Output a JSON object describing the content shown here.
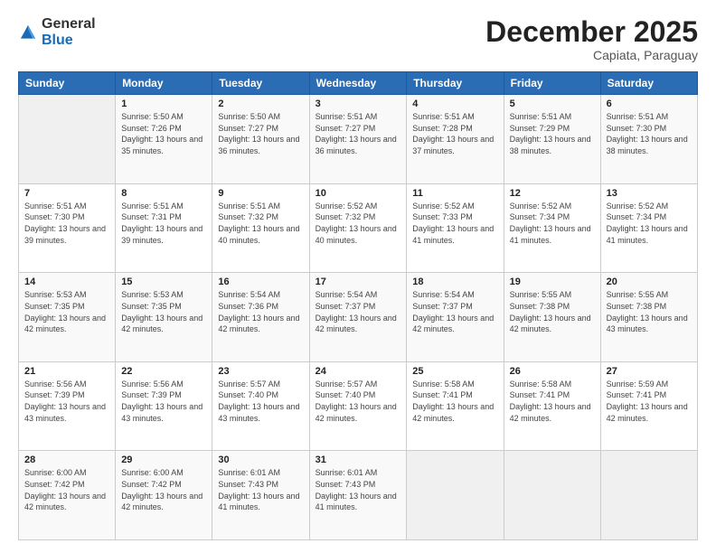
{
  "logo": {
    "general": "General",
    "blue": "Blue"
  },
  "header": {
    "month": "December 2025",
    "location": "Capiata, Paraguay"
  },
  "days_of_week": [
    "Sunday",
    "Monday",
    "Tuesday",
    "Wednesday",
    "Thursday",
    "Friday",
    "Saturday"
  ],
  "weeks": [
    [
      {
        "day": "",
        "sunrise": "",
        "sunset": "",
        "daylight": ""
      },
      {
        "day": "1",
        "sunrise": "Sunrise: 5:50 AM",
        "sunset": "Sunset: 7:26 PM",
        "daylight": "Daylight: 13 hours and 35 minutes."
      },
      {
        "day": "2",
        "sunrise": "Sunrise: 5:50 AM",
        "sunset": "Sunset: 7:27 PM",
        "daylight": "Daylight: 13 hours and 36 minutes."
      },
      {
        "day": "3",
        "sunrise": "Sunrise: 5:51 AM",
        "sunset": "Sunset: 7:27 PM",
        "daylight": "Daylight: 13 hours and 36 minutes."
      },
      {
        "day": "4",
        "sunrise": "Sunrise: 5:51 AM",
        "sunset": "Sunset: 7:28 PM",
        "daylight": "Daylight: 13 hours and 37 minutes."
      },
      {
        "day": "5",
        "sunrise": "Sunrise: 5:51 AM",
        "sunset": "Sunset: 7:29 PM",
        "daylight": "Daylight: 13 hours and 38 minutes."
      },
      {
        "day": "6",
        "sunrise": "Sunrise: 5:51 AM",
        "sunset": "Sunset: 7:30 PM",
        "daylight": "Daylight: 13 hours and 38 minutes."
      }
    ],
    [
      {
        "day": "7",
        "sunrise": "Sunrise: 5:51 AM",
        "sunset": "Sunset: 7:30 PM",
        "daylight": "Daylight: 13 hours and 39 minutes."
      },
      {
        "day": "8",
        "sunrise": "Sunrise: 5:51 AM",
        "sunset": "Sunset: 7:31 PM",
        "daylight": "Daylight: 13 hours and 39 minutes."
      },
      {
        "day": "9",
        "sunrise": "Sunrise: 5:51 AM",
        "sunset": "Sunset: 7:32 PM",
        "daylight": "Daylight: 13 hours and 40 minutes."
      },
      {
        "day": "10",
        "sunrise": "Sunrise: 5:52 AM",
        "sunset": "Sunset: 7:32 PM",
        "daylight": "Daylight: 13 hours and 40 minutes."
      },
      {
        "day": "11",
        "sunrise": "Sunrise: 5:52 AM",
        "sunset": "Sunset: 7:33 PM",
        "daylight": "Daylight: 13 hours and 41 minutes."
      },
      {
        "day": "12",
        "sunrise": "Sunrise: 5:52 AM",
        "sunset": "Sunset: 7:34 PM",
        "daylight": "Daylight: 13 hours and 41 minutes."
      },
      {
        "day": "13",
        "sunrise": "Sunrise: 5:52 AM",
        "sunset": "Sunset: 7:34 PM",
        "daylight": "Daylight: 13 hours and 41 minutes."
      }
    ],
    [
      {
        "day": "14",
        "sunrise": "Sunrise: 5:53 AM",
        "sunset": "Sunset: 7:35 PM",
        "daylight": "Daylight: 13 hours and 42 minutes."
      },
      {
        "day": "15",
        "sunrise": "Sunrise: 5:53 AM",
        "sunset": "Sunset: 7:35 PM",
        "daylight": "Daylight: 13 hours and 42 minutes."
      },
      {
        "day": "16",
        "sunrise": "Sunrise: 5:54 AM",
        "sunset": "Sunset: 7:36 PM",
        "daylight": "Daylight: 13 hours and 42 minutes."
      },
      {
        "day": "17",
        "sunrise": "Sunrise: 5:54 AM",
        "sunset": "Sunset: 7:37 PM",
        "daylight": "Daylight: 13 hours and 42 minutes."
      },
      {
        "day": "18",
        "sunrise": "Sunrise: 5:54 AM",
        "sunset": "Sunset: 7:37 PM",
        "daylight": "Daylight: 13 hours and 42 minutes."
      },
      {
        "day": "19",
        "sunrise": "Sunrise: 5:55 AM",
        "sunset": "Sunset: 7:38 PM",
        "daylight": "Daylight: 13 hours and 42 minutes."
      },
      {
        "day": "20",
        "sunrise": "Sunrise: 5:55 AM",
        "sunset": "Sunset: 7:38 PM",
        "daylight": "Daylight: 13 hours and 43 minutes."
      }
    ],
    [
      {
        "day": "21",
        "sunrise": "Sunrise: 5:56 AM",
        "sunset": "Sunset: 7:39 PM",
        "daylight": "Daylight: 13 hours and 43 minutes."
      },
      {
        "day": "22",
        "sunrise": "Sunrise: 5:56 AM",
        "sunset": "Sunset: 7:39 PM",
        "daylight": "Daylight: 13 hours and 43 minutes."
      },
      {
        "day": "23",
        "sunrise": "Sunrise: 5:57 AM",
        "sunset": "Sunset: 7:40 PM",
        "daylight": "Daylight: 13 hours and 43 minutes."
      },
      {
        "day": "24",
        "sunrise": "Sunrise: 5:57 AM",
        "sunset": "Sunset: 7:40 PM",
        "daylight": "Daylight: 13 hours and 42 minutes."
      },
      {
        "day": "25",
        "sunrise": "Sunrise: 5:58 AM",
        "sunset": "Sunset: 7:41 PM",
        "daylight": "Daylight: 13 hours and 42 minutes."
      },
      {
        "day": "26",
        "sunrise": "Sunrise: 5:58 AM",
        "sunset": "Sunset: 7:41 PM",
        "daylight": "Daylight: 13 hours and 42 minutes."
      },
      {
        "day": "27",
        "sunrise": "Sunrise: 5:59 AM",
        "sunset": "Sunset: 7:41 PM",
        "daylight": "Daylight: 13 hours and 42 minutes."
      }
    ],
    [
      {
        "day": "28",
        "sunrise": "Sunrise: 6:00 AM",
        "sunset": "Sunset: 7:42 PM",
        "daylight": "Daylight: 13 hours and 42 minutes."
      },
      {
        "day": "29",
        "sunrise": "Sunrise: 6:00 AM",
        "sunset": "Sunset: 7:42 PM",
        "daylight": "Daylight: 13 hours and 42 minutes."
      },
      {
        "day": "30",
        "sunrise": "Sunrise: 6:01 AM",
        "sunset": "Sunset: 7:43 PM",
        "daylight": "Daylight: 13 hours and 41 minutes."
      },
      {
        "day": "31",
        "sunrise": "Sunrise: 6:01 AM",
        "sunset": "Sunset: 7:43 PM",
        "daylight": "Daylight: 13 hours and 41 minutes."
      },
      {
        "day": "",
        "sunrise": "",
        "sunset": "",
        "daylight": ""
      },
      {
        "day": "",
        "sunrise": "",
        "sunset": "",
        "daylight": ""
      },
      {
        "day": "",
        "sunrise": "",
        "sunset": "",
        "daylight": ""
      }
    ]
  ]
}
